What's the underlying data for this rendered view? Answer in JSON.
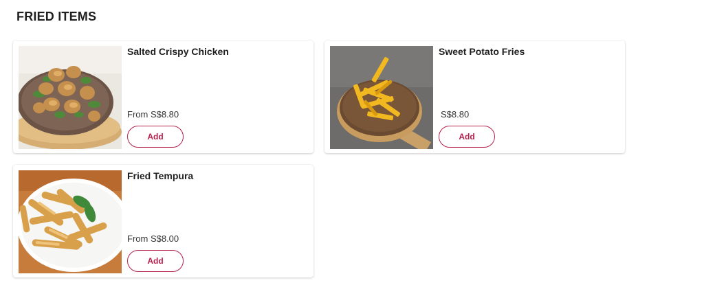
{
  "section": {
    "title": "FRIED ITEMS"
  },
  "items": [
    {
      "name": "Salted Crispy Chicken",
      "price": "From S$8.80",
      "add_label": "Add",
      "image_icon": "salted-crispy-chicken-photo"
    },
    {
      "name": "Sweet Potato Fries",
      "price": "S$8.80",
      "add_label": "Add",
      "image_icon": "sweet-potato-fries-photo"
    },
    {
      "name": "Fried Tempura",
      "price": "From S$8.00",
      "add_label": "Add",
      "image_icon": "fried-tempura-photo"
    }
  ],
  "colors": {
    "accent": "#b51f4a",
    "text": "#1f1f1f"
  }
}
